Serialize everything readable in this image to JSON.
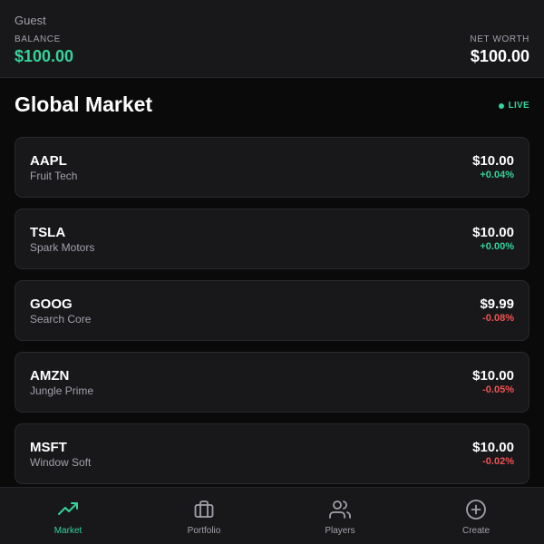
{
  "header": {
    "user_name": "Guest",
    "balance_label": "BALANCE",
    "balance_value": "$100.00",
    "net_worth_label": "NET WORTH",
    "net_worth_value": "$100.00"
  },
  "market": {
    "title": "Global Market",
    "live_label": "LIVE",
    "stocks": [
      {
        "ticker": "AAPL",
        "name": "Fruit Tech",
        "price": "$10.00",
        "change": "+0.04%",
        "direction": "up"
      },
      {
        "ticker": "TSLA",
        "name": "Spark Motors",
        "price": "$10.00",
        "change": "+0.00%",
        "direction": "up"
      },
      {
        "ticker": "GOOG",
        "name": "Search Core",
        "price": "$9.99",
        "change": "-0.08%",
        "direction": "down"
      },
      {
        "ticker": "AMZN",
        "name": "Jungle Prime",
        "price": "$10.00",
        "change": "-0.05%",
        "direction": "down"
      },
      {
        "ticker": "MSFT",
        "name": "Window Soft",
        "price": "$10.00",
        "change": "-0.02%",
        "direction": "down"
      }
    ]
  },
  "nav": {
    "items": [
      {
        "label": "Market",
        "icon": "trending-up-icon",
        "active": true
      },
      {
        "label": "Portfolio",
        "icon": "briefcase-icon",
        "active": false
      },
      {
        "label": "Players",
        "icon": "users-icon",
        "active": false
      },
      {
        "label": "Create",
        "icon": "plus-circle-icon",
        "active": false
      }
    ]
  },
  "colors": {
    "accent": "#34d399",
    "negative": "#f05252",
    "background": "#0a0a0b",
    "surface": "#18181b"
  }
}
